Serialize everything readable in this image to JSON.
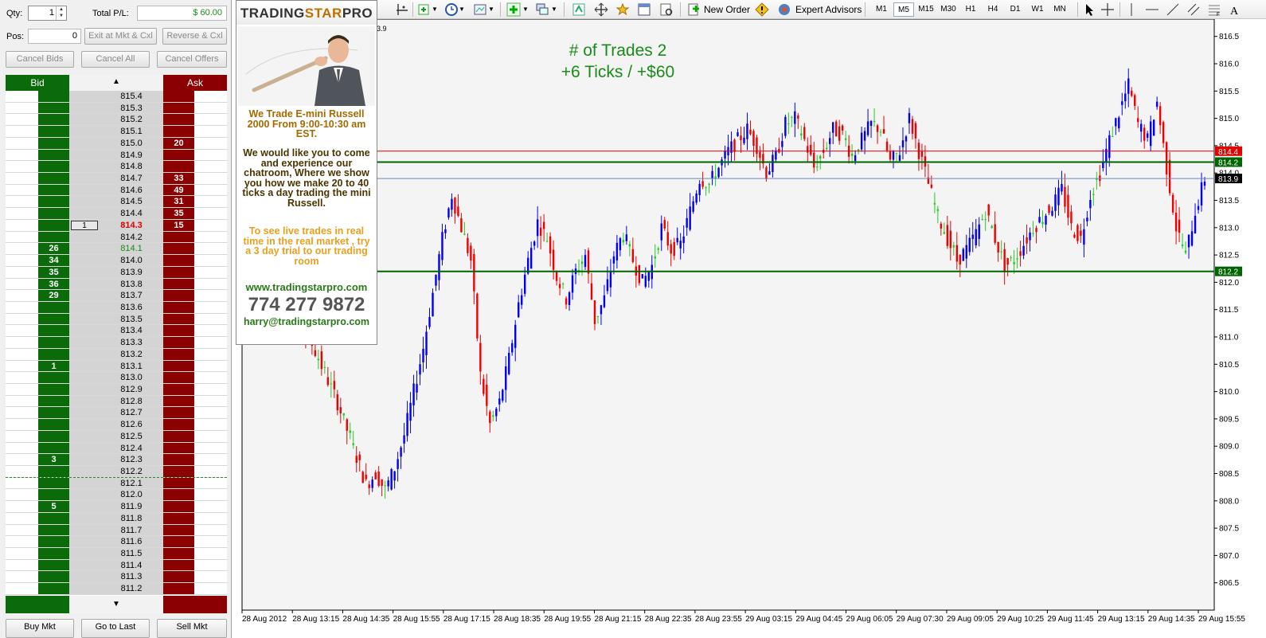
{
  "dom": {
    "qty_label": "Qty:",
    "qty_value": "1",
    "total_pl_label": "Total P/L:",
    "total_pl_value": "$ 60.00",
    "pos_label": "Pos:",
    "pos_value": "0",
    "exit_button": "Exit at Mkt & Cxl",
    "reverse_button": "Reverse & Cxl",
    "cancel_bids_button": "Cancel Bids",
    "cancel_all_button": "Cancel All",
    "cancel_offers_button": "Cancel Offers",
    "bid_header": "Bid",
    "ask_header": "Ask",
    "scroll_up": "▲",
    "scroll_down": "▼",
    "buy_mkt_button": "Buy Mkt",
    "go_to_last_button": "Go to Last",
    "sell_mkt_button": "Sell Mkt",
    "rows": [
      {
        "price": "815.4",
        "bid": "",
        "ask": "",
        "mine": ""
      },
      {
        "price": "815.3",
        "bid": "",
        "ask": "",
        "mine": ""
      },
      {
        "price": "815.2",
        "bid": "",
        "ask": "",
        "mine": ""
      },
      {
        "price": "815.1",
        "bid": "",
        "ask": "",
        "mine": ""
      },
      {
        "price": "815.0",
        "bid": "",
        "ask": "20",
        "mine": ""
      },
      {
        "price": "814.9",
        "bid": "",
        "ask": "",
        "mine": ""
      },
      {
        "price": "814.8",
        "bid": "",
        "ask": "",
        "mine": ""
      },
      {
        "price": "814.7",
        "bid": "",
        "ask": "33",
        "mine": ""
      },
      {
        "price": "814.6",
        "bid": "",
        "ask": "49",
        "mine": ""
      },
      {
        "price": "814.5",
        "bid": "",
        "ask": "31",
        "mine": ""
      },
      {
        "price": "814.4",
        "bid": "",
        "ask": "35",
        "mine": ""
      },
      {
        "price": "814.3",
        "bid": "",
        "ask": "15",
        "mine": "1",
        "state": "last"
      },
      {
        "price": "814.2",
        "bid": "",
        "ask": "",
        "mine": ""
      },
      {
        "price": "814.1",
        "bid": "26",
        "ask": "",
        "mine": "",
        "state": "bidlast"
      },
      {
        "price": "814.0",
        "bid": "34",
        "ask": "",
        "mine": ""
      },
      {
        "price": "813.9",
        "bid": "35",
        "ask": "",
        "mine": ""
      },
      {
        "price": "813.8",
        "bid": "36",
        "ask": "",
        "mine": ""
      },
      {
        "price": "813.7",
        "bid": "29",
        "ask": "",
        "mine": ""
      },
      {
        "price": "813.6",
        "bid": "",
        "ask": "",
        "mine": ""
      },
      {
        "price": "813.5",
        "bid": "",
        "ask": "",
        "mine": ""
      },
      {
        "price": "813.4",
        "bid": "",
        "ask": "",
        "mine": ""
      },
      {
        "price": "813.3",
        "bid": "",
        "ask": "",
        "mine": ""
      },
      {
        "price": "813.2",
        "bid": "",
        "ask": "",
        "mine": ""
      },
      {
        "price": "813.1",
        "bid": "1",
        "ask": "",
        "mine": ""
      },
      {
        "price": "813.0",
        "bid": "",
        "ask": "",
        "mine": ""
      },
      {
        "price": "812.9",
        "bid": "",
        "ask": "",
        "mine": ""
      },
      {
        "price": "812.8",
        "bid": "",
        "ask": "",
        "mine": ""
      },
      {
        "price": "812.7",
        "bid": "",
        "ask": "",
        "mine": ""
      },
      {
        "price": "812.6",
        "bid": "",
        "ask": "",
        "mine": ""
      },
      {
        "price": "812.5",
        "bid": "",
        "ask": "",
        "mine": ""
      },
      {
        "price": "812.4",
        "bid": "",
        "ask": "",
        "mine": ""
      },
      {
        "price": "812.3",
        "bid": "3",
        "ask": "",
        "mine": ""
      },
      {
        "price": "812.2",
        "bid": "",
        "ask": "",
        "mine": "",
        "state": "dashed"
      },
      {
        "price": "812.1",
        "bid": "",
        "ask": "",
        "mine": ""
      },
      {
        "price": "812.0",
        "bid": "",
        "ask": "",
        "mine": ""
      },
      {
        "price": "811.9",
        "bid": "5",
        "ask": "",
        "mine": ""
      },
      {
        "price": "811.8",
        "bid": "",
        "ask": "",
        "mine": ""
      },
      {
        "price": "811.7",
        "bid": "",
        "ask": "",
        "mine": ""
      },
      {
        "price": "811.6",
        "bid": "",
        "ask": "",
        "mine": ""
      },
      {
        "price": "811.5",
        "bid": "",
        "ask": "",
        "mine": ""
      },
      {
        "price": "811.4",
        "bid": "",
        "ask": "",
        "mine": ""
      },
      {
        "price": "811.3",
        "bid": "",
        "ask": "",
        "mine": ""
      },
      {
        "price": "811.2",
        "bid": "",
        "ask": "",
        "mine": ""
      }
    ]
  },
  "ad": {
    "brand_a": "TRADING",
    "brand_b": "STAR",
    "brand_c": "PRO",
    "line1": "We Trade E-mini Russell 2000 From 9:00-10:30 am EST.",
    "line2": "We would like you to come and experience our chatroom, Where we show you how we make 20 to 40 ticks a day trading the mini Russell.",
    "line3": "To see live trades in real time in the real market , try a 3 day trial to our trading room",
    "website": "www.tradingstarpro.com",
    "phone": "774 277 9872",
    "email": "harry@tradingstarpro.com"
  },
  "toolbar": {
    "new_order": "New Order",
    "expert_advisors": "Expert Advisors",
    "timeframes": [
      "M1",
      "M5",
      "M15",
      "M30",
      "H1",
      "H4",
      "D1",
      "W1",
      "MN"
    ],
    "selected_timeframe": "M5",
    "icons": [
      "crosshair-icon",
      "zoom-icon",
      "indicators-icon",
      "clock-icon",
      "templates-icon",
      "new-order-icon",
      "experts-icon",
      "cursor-icon",
      "line-icon",
      "fibo-icon"
    ]
  },
  "chart": {
    "title_line1": "# of Trades 2",
    "title_line2": "+6 Ticks / +$60",
    "partial_price_label": "3.9",
    "colors": {
      "up": "#0000ee",
      "down": "#ee0000",
      "doji": "#22cc22",
      "hline_green": "#006400",
      "hline_red": "#e00000",
      "hline_blue": "#6688cc"
    }
  },
  "chart_data": {
    "type": "candlestick",
    "symbol_timeframe": "M5",
    "ylim": [
      806.0,
      816.7
    ],
    "y_ticks": [
      "806.5",
      "807.0",
      "807.5",
      "808.0",
      "808.5",
      "809.0",
      "809.5",
      "810.0",
      "810.5",
      "811.0",
      "811.5",
      "812.0",
      "812.5",
      "813.0",
      "813.5",
      "814.0",
      "814.5",
      "815.0",
      "815.5",
      "816.0",
      "816.5"
    ],
    "x_ticks": [
      "28 Aug 2012",
      "28 Aug 13:15",
      "28 Aug 14:35",
      "28 Aug 15:55",
      "28 Aug 17:15",
      "28 Aug 18:35",
      "28 Aug 19:55",
      "28 Aug 21:15",
      "28 Aug 22:35",
      "28 Aug 23:55",
      "29 Aug 03:15",
      "29 Aug 04:45",
      "29 Aug 06:05",
      "29 Aug 07:30",
      "29 Aug 09:05",
      "29 Aug 10:25",
      "29 Aug 11:45",
      "29 Aug 13:15",
      "29 Aug 14:35",
      "29 Aug 15:55"
    ],
    "price_labels": [
      {
        "value": 814.4,
        "text": "814.4",
        "color": "#e00000"
      },
      {
        "value": 814.2,
        "text": "814.2",
        "color": "#006400"
      },
      {
        "value": 813.9,
        "text": "813.9",
        "color": "#000000"
      },
      {
        "value": 812.2,
        "text": "812.2",
        "color": "#006400"
      }
    ],
    "hlines": [
      {
        "value": 814.4,
        "color": "#e00000"
      },
      {
        "value": 814.2,
        "color": "#006400"
      },
      {
        "value": 813.9,
        "color": "#6688cc"
      },
      {
        "value": 812.2,
        "color": "#006400"
      }
    ],
    "close_path": [
      811.8,
      811.5,
      811.2,
      811.0,
      810.6,
      810.2,
      809.8,
      809.3,
      808.8,
      808.3,
      808.5,
      808.2,
      808.6,
      809.2,
      810.0,
      810.8,
      811.8,
      812.8,
      813.6,
      813.0,
      812.4,
      810.3,
      809.4,
      809.8,
      810.6,
      811.6,
      812.4,
      813.1,
      812.8,
      812.1,
      811.7,
      812.2,
      812.5,
      811.3,
      811.7,
      812.5,
      812.9,
      812.4,
      812.0,
      812.3,
      813.0,
      812.6,
      812.7,
      813.3,
      813.9,
      813.8,
      814.1,
      814.4,
      814.6,
      814.8,
      814.5,
      814.0,
      814.3,
      814.9,
      815.0,
      814.6,
      814.1,
      814.4,
      814.8,
      814.7,
      814.3,
      814.6,
      814.9,
      814.8,
      814.2,
      814.4,
      815.0,
      814.4,
      813.8,
      813.2,
      812.8,
      812.4,
      812.6,
      812.9,
      813.3,
      812.8,
      812.3,
      812.4,
      812.7,
      813.0,
      813.2,
      813.4,
      813.7,
      813.0,
      812.8,
      813.6,
      814.0,
      814.6,
      815.1,
      815.6,
      814.9,
      814.6,
      815.3,
      814.1,
      813.0,
      812.5,
      813.3,
      813.9
    ]
  }
}
